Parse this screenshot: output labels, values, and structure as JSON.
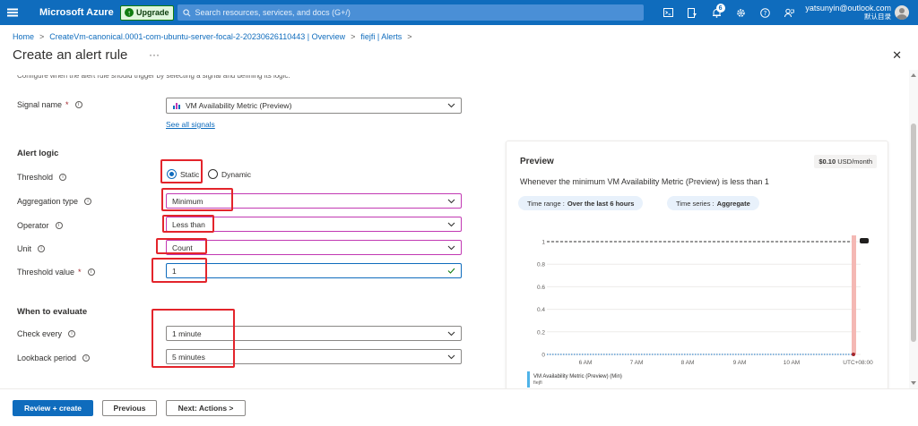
{
  "topbar": {
    "brand": "Microsoft Azure",
    "upgrade": "Upgrade",
    "search_placeholder": "Search resources, services, and docs (G+/)",
    "notification_count": "6",
    "email": "yatsunyin@outlook.com",
    "directory": "默认目录"
  },
  "breadcrumb": [
    "Home",
    "CreateVm-canonical.0001-com-ubuntu-server-focal-2-20230626110443 | Overview",
    "fiejfi | Alerts"
  ],
  "page": {
    "title": "Create an alert rule",
    "more": "···",
    "description": "Configure when the alert rule should trigger by selecting a signal and defining its logic."
  },
  "signal": {
    "label": "Signal name",
    "required": "*",
    "value": "VM Availability Metric (Preview)",
    "see_all": "See all signals"
  },
  "alert_logic": {
    "heading": "Alert logic",
    "threshold_label": "Threshold",
    "threshold_options": [
      "Static",
      "Dynamic"
    ],
    "threshold_selected": "Static",
    "aggregation_label": "Aggregation type",
    "aggregation_value": "Minimum",
    "operator_label": "Operator",
    "operator_value": "Less than",
    "unit_label": "Unit",
    "unit_value": "Count",
    "threshold_value_label": "Threshold value",
    "threshold_value": "1"
  },
  "evaluate": {
    "heading": "When to evaluate",
    "check_every_label": "Check every",
    "check_every_value": "1 minute",
    "lookback_label": "Lookback period",
    "lookback_value": "5 minutes"
  },
  "preview": {
    "title": "Preview",
    "price_amount": "$0.10",
    "price_unit": "USD/month",
    "description": "Whenever the minimum VM Availability Metric (Preview) is less than 1",
    "time_range_label": "Time range :",
    "time_range_value": "Over the last 6 hours",
    "time_series_label": "Time series :",
    "time_series_value": "Aggregate"
  },
  "chart_data": {
    "type": "line",
    "y_ticks": [
      "1",
      "0.8",
      "0.6",
      "0.4",
      "0.2",
      "0"
    ],
    "ylim": [
      0,
      1
    ],
    "x_ticks": [
      "6 AM",
      "7 AM",
      "8 AM",
      "9 AM",
      "10 AM",
      "UTC+08:00"
    ],
    "threshold": 1,
    "legend_series": "VM Availability Metric (Preview) (Min)",
    "legend_resource": "fiejfi"
  },
  "footer": {
    "review_create": "Review + create",
    "previous": "Previous",
    "next": "Next: Actions >"
  }
}
